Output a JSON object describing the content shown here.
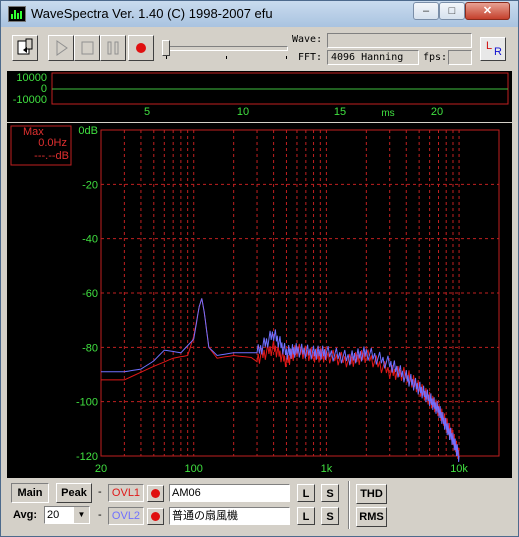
{
  "window": {
    "title": "WaveSpectra  Ver. 1.40  (C) 1998-2007 efu"
  },
  "toolbar": {
    "wave_label": "Wave:",
    "wave_value": "",
    "fft_label": "FFT:",
    "fft_value": "4096 Hanning",
    "fps_label": "fps:",
    "fps_value": "",
    "lr_label_l": "L",
    "lr_label_r": "R"
  },
  "waveform": {
    "y_labels": [
      "10000",
      "0",
      "-10000"
    ],
    "x_labels": [
      "5",
      "10",
      "15",
      "20"
    ],
    "unit": "ms"
  },
  "spectrum": {
    "max_label": "Max",
    "max_freq": "0.0Hz",
    "max_db": "---.--dB",
    "y_labels": [
      "0dB",
      "-20",
      "-40",
      "-60",
      "-80",
      "-100",
      "-120"
    ],
    "x_labels": [
      "20",
      "100",
      "1k",
      "10k"
    ],
    "colors": {
      "grid": "#c02020",
      "axis_text": "#40e040",
      "left_channel": "#e01818",
      "right_channel": "#7070ff"
    }
  },
  "chart_data": {
    "type": "line",
    "title": "",
    "xlabel": "",
    "ylabel": "",
    "x_scale": "log",
    "xlim": [
      20,
      20000
    ],
    "ylim": [
      -120,
      0
    ],
    "series": [
      {
        "color": "#e01818",
        "x": [
          20,
          30,
          50,
          70,
          90,
          100,
          110,
          115,
          120,
          130,
          150,
          200,
          300,
          400,
          500,
          600,
          800,
          1000,
          1500,
          2000,
          3000,
          4000,
          5000,
          6000,
          7000,
          8000,
          9000,
          10000
        ],
        "y": [
          -92,
          -92,
          -87,
          -84,
          -83,
          -76,
          -65,
          -62,
          -67,
          -80,
          -84,
          -83,
          -84,
          -80,
          -85,
          -81,
          -83,
          -83,
          -85,
          -83,
          -89,
          -90,
          -95,
          -99,
          -103,
          -108,
          -113,
          -120
        ]
      },
      {
        "color": "#7070ff",
        "x": [
          20,
          25,
          30,
          40,
          50,
          60,
          80,
          100,
          110,
          115,
          120,
          130,
          150,
          200,
          300,
          400,
          500,
          600,
          800,
          1000,
          1500,
          2000,
          3000,
          4000,
          5000,
          6000,
          7000,
          8000,
          9000,
          10000
        ],
        "y": [
          -89,
          -89,
          -89,
          -88,
          -85,
          -81,
          -82,
          -77,
          -65,
          -62,
          -67,
          -80,
          -83,
          -82,
          -82,
          -75,
          -82,
          -81,
          -82,
          -82,
          -84,
          -82,
          -86,
          -91,
          -95,
          -99,
          -103,
          -109,
          -114,
          -120
        ]
      }
    ]
  },
  "bottom": {
    "main_label": "Main",
    "peak_label": "Peak",
    "avg_label": "Avg:",
    "avg_value": "20",
    "dash": "-",
    "ovl1_label": "OVL1",
    "ovl2_label": "OVL2",
    "ovl1_name": "AM06",
    "ovl2_name": "普通の扇風機",
    "l_label": "L",
    "s_label": "S",
    "thd_label": "THD",
    "rms_label": "RMS",
    "ovl1_color": "#e01818",
    "ovl2_color": "#7070ff"
  }
}
